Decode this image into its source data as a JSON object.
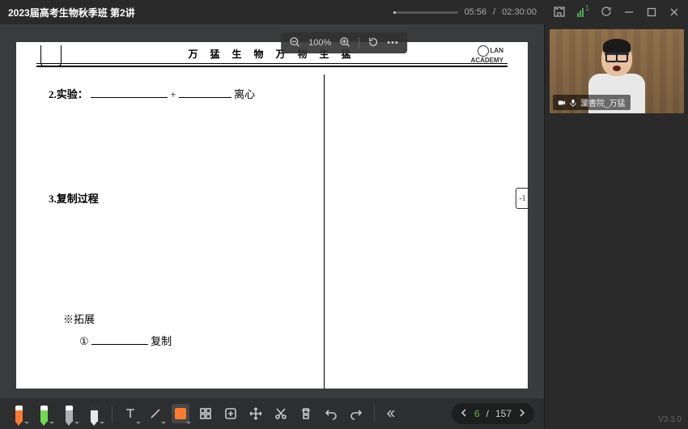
{
  "titlebar": {
    "title": "2023届高考生物秋季班 第2讲",
    "time_current": "05:56",
    "time_total": "02:30:00",
    "signal_count": "1"
  },
  "zoom_toolbar": {
    "zoom_level": "100%"
  },
  "document": {
    "header_text": "万 猛 生 物   万 物 生 猛",
    "academy": "LAN ACADEMY",
    "line2_label": "2.实验：",
    "line2_plus": "+",
    "line2_suffix": "离心",
    "line3_label": "3.复制过程",
    "ext_label": "※拓展",
    "ext_item1_num": "①",
    "ext_item1_suffix": "复制",
    "side_page": "-1"
  },
  "presenter": {
    "name": "瀾書院_万猛"
  },
  "pager": {
    "current": "6",
    "total": "157",
    "sep": "/"
  },
  "version": "V3.3.0"
}
